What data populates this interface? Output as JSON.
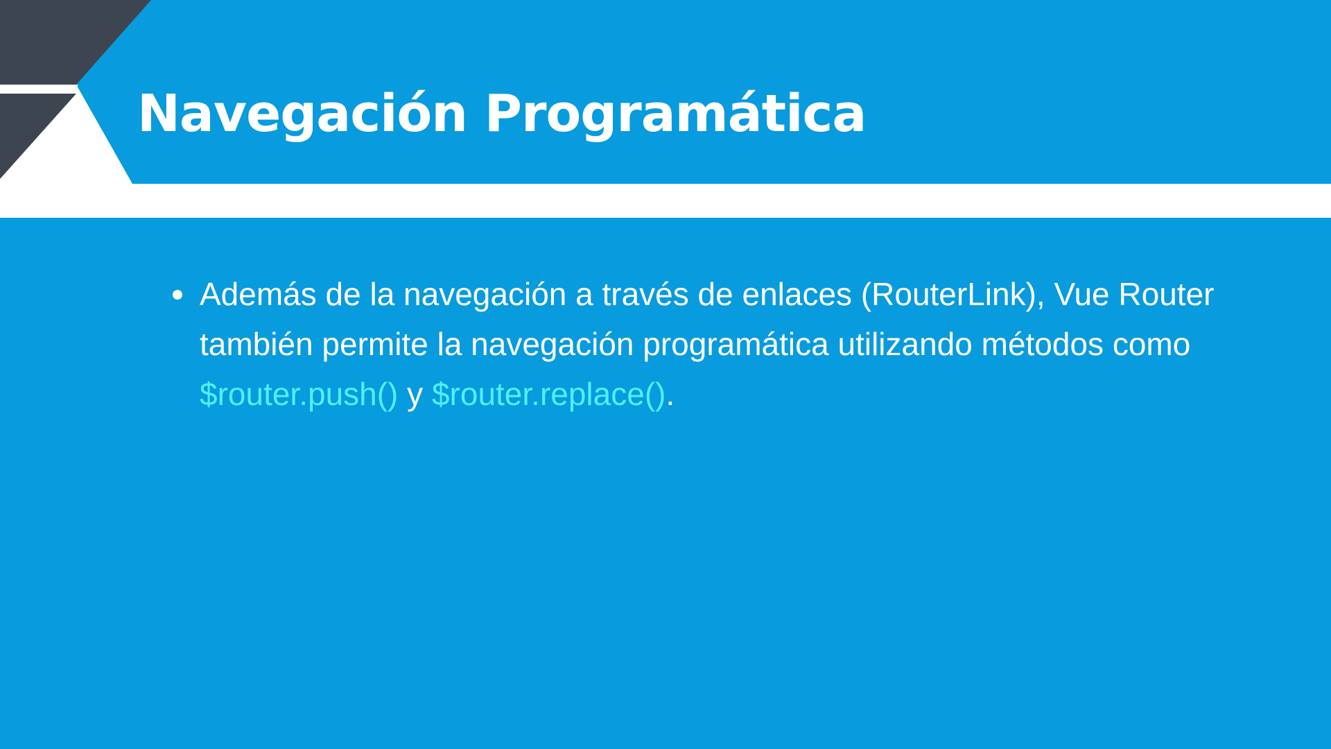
{
  "slide": {
    "title": "Navegación Programática",
    "colors": {
      "background": "#089bdd",
      "white_band": "#ffffff",
      "corner_dark": "#3d4550",
      "code_highlight": "#4ef0f7",
      "text": "#ffffff"
    }
  },
  "bullets": [
    {
      "text_before": "Además de la navegación a través de enlaces (RouterLink), Vue Router también permite la navegación programática utilizando métodos como ",
      "code_1": "$router.push()",
      "text_between": " y ",
      "code_2": "$router.replace()",
      "text_after": "."
    }
  ]
}
